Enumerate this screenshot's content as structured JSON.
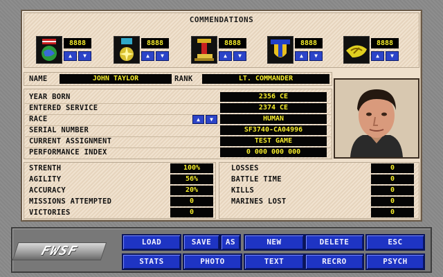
{
  "commendations": {
    "title": "COMMENDATIONS",
    "medals": [
      {
        "icon": "globe-medal-icon",
        "count": "8888"
      },
      {
        "icon": "star-medal-icon",
        "count": "8888"
      },
      {
        "icon": "ribbon-medal-icon",
        "count": "8888"
      },
      {
        "icon": "shield-medal-icon",
        "count": "8888"
      },
      {
        "icon": "wing-medal-icon",
        "count": "8888"
      }
    ]
  },
  "identity": {
    "name_label": "NAME",
    "name": "JOHN TAYLOR",
    "rank_label": "RANK",
    "rank": "LT. COMMANDER"
  },
  "service": {
    "year_born_label": "YEAR BORN",
    "year_born": "2356 CE",
    "entered_label": "ENTERED SERVICE",
    "entered": "2374 CE",
    "race_label": "RACE",
    "race": "HUMAN",
    "serial_label": "SERIAL NUMBER",
    "serial": "SF3740-CA04996",
    "assignment_label": "CURRENT ASSIGNMENT",
    "assignment": "TEST GAME",
    "performance_label": "PERFORMANCE INDEX",
    "performance": "0 000 000 000"
  },
  "stats_left": [
    {
      "label": "STRENTH",
      "value": "100%"
    },
    {
      "label": "AGILITY",
      "value": "56%"
    },
    {
      "label": "ACCURACY",
      "value": "20%"
    },
    {
      "label": "MISSIONS ATTEMPTED",
      "value": "0"
    },
    {
      "label": "VICTORIES",
      "value": "0"
    }
  ],
  "stats_right": [
    {
      "label": "LOSSES",
      "value": "0"
    },
    {
      "label": "BATTLE TIME",
      "value": "0"
    },
    {
      "label": "KILLS",
      "value": "0"
    },
    {
      "label": "MARINES LOST",
      "value": "0"
    },
    {
      "label": "",
      "value": "0"
    }
  ],
  "controls": {
    "logo": "FWSF",
    "load": "LOAD",
    "save": "SAVE",
    "as": "AS",
    "new": "NEW",
    "delete": "DELETE",
    "esc": "ESC",
    "stats": "STATS",
    "photo": "PHOTO",
    "text": "TEXT",
    "recro": "RECRO",
    "psych": "PSYCH"
  },
  "colors": {
    "accent_blue": "#1e34c4",
    "value_yellow": "#f5ec2a",
    "panel_tan": "#efe0cc"
  }
}
